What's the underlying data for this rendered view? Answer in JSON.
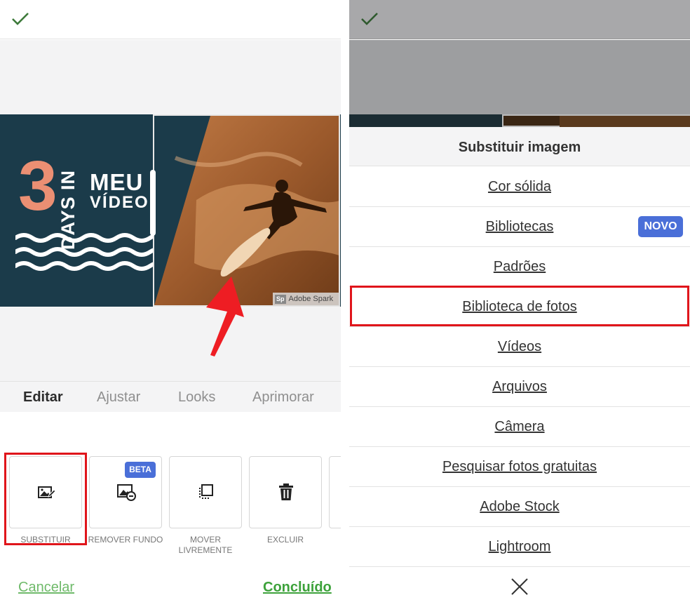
{
  "left": {
    "poster": {
      "number": "3",
      "days_in": "DAYS IN",
      "line1": "MEU",
      "line2": "VÍDEO",
      "watermark_logo": "Sp",
      "watermark_text": "Adobe Spark"
    },
    "tabs": [
      {
        "label": "Editar",
        "active": true
      },
      {
        "label": "Ajustar",
        "active": false
      },
      {
        "label": "Looks",
        "active": false
      },
      {
        "label": "Aprimorar",
        "active": false
      }
    ],
    "tools": [
      {
        "label": "SUBSTITUIR",
        "icon": "replace-image-icon",
        "selected": true
      },
      {
        "label": "REMOVER FUNDO",
        "icon": "remove-background-icon",
        "badge": "BETA"
      },
      {
        "label": "MOVER LIVREMENTE",
        "icon": "move-freely-icon"
      },
      {
        "label": "EXCLUIR",
        "icon": "trash-icon"
      }
    ],
    "cancel_label": "Cancelar",
    "done_label": "Concluído"
  },
  "right": {
    "sheet_title": "Substituir imagem",
    "items": [
      {
        "label": "Cor sólida"
      },
      {
        "label": "Bibliotecas",
        "badge": "NOVO"
      },
      {
        "label": "Padrões"
      },
      {
        "label": "Biblioteca de fotos",
        "selected": true
      },
      {
        "label": "Vídeos"
      },
      {
        "label": "Arquivos"
      },
      {
        "label": "Câmera"
      },
      {
        "label": "Pesquisar fotos gratuitas"
      },
      {
        "label": "Adobe Stock"
      },
      {
        "label": "Lightroom"
      }
    ]
  },
  "colors": {
    "accent_green": "#3da23b",
    "highlight_red": "#e0151b",
    "badge_blue": "#4a6fd8",
    "poster_navy": "#1b3b4a",
    "poster_salmon": "#eb8f73"
  }
}
